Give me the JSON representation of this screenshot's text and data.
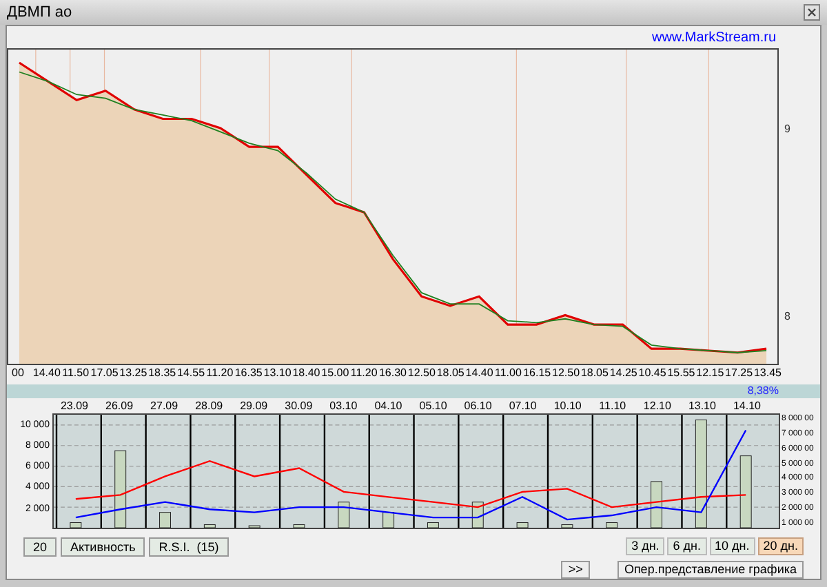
{
  "window": {
    "title": "ДВМП ао"
  },
  "link": "www.MarkStream.ru",
  "price_chart": {
    "chart_data": {
      "type": "area",
      "categories": [
        "00",
        "14.40",
        "11.50",
        "17.05",
        "13.25",
        "18.35",
        "14.55",
        "11.20",
        "16.35",
        "13.10",
        "18.40",
        "15.00",
        "11.20",
        "16.30",
        "12.50",
        "18.05",
        "14.40",
        "11.00",
        "16.15",
        "12.50",
        "18.05",
        "14.25",
        "10.45",
        "15.55",
        "12.15",
        "17.25",
        "13.45"
      ],
      "ylim": [
        7.74,
        9.42
      ],
      "yticks": [
        {
          "value": 9,
          "label": "9"
        },
        {
          "value": 8,
          "label": "8"
        }
      ],
      "grid": true,
      "series": [
        {
          "color": "#e00000",
          "values": [
            9.35,
            9.25,
            9.15,
            9.2,
            9.1,
            9.05,
            9.05,
            9.0,
            8.9,
            8.9,
            8.75,
            8.6,
            8.55,
            8.3,
            8.1,
            8.05,
            8.1,
            7.95,
            7.95,
            8.0,
            7.95,
            7.95,
            7.82,
            7.82,
            7.81,
            7.8,
            7.82
          ]
        },
        {
          "type": "line",
          "color": "#208020",
          "values": [
            9.3,
            9.25,
            9.18,
            9.16,
            9.1,
            9.07,
            9.04,
            8.98,
            8.92,
            8.88,
            8.76,
            8.62,
            8.55,
            8.32,
            8.12,
            8.06,
            8.06,
            7.97,
            7.96,
            7.98,
            7.95,
            7.94,
            7.84,
            7.82,
            7.81,
            7.8,
            7.81
          ]
        }
      ]
    }
  },
  "change": "8,38%",
  "volume_chart": {
    "chart_data": {
      "type": "line",
      "grid": true,
      "categories": [
        "23.09",
        "26.09",
        "27.09",
        "28.09",
        "29.09",
        "30.09",
        "03.10",
        "04.10",
        "05.10",
        "06.10",
        "07.10",
        "10.10",
        "11.10",
        "12.10",
        "13.10",
        "14.10"
      ],
      "ylim": [
        0,
        11000
      ],
      "yticks": [
        {
          "value": 10000,
          "label": "10 000"
        },
        {
          "value": 8000,
          "label": "8 000"
        },
        {
          "value": 6000,
          "label": "6 000"
        },
        {
          "value": 4000,
          "label": "4 000"
        },
        {
          "value": 2000,
          "label": "2 000"
        }
      ],
      "series": [
        {
          "color": "#ff0000",
          "values": [
            2800,
            3200,
            5000,
            6500,
            5000,
            5800,
            3500,
            3000,
            2500,
            2000,
            3500,
            3800,
            2000,
            2500,
            3000,
            3200
          ]
        },
        {
          "color": "#0000ff",
          "values": [
            1000,
            1800,
            2500,
            1800,
            1500,
            2000,
            2000,
            1500,
            1000,
            1000,
            3000,
            800,
            1200,
            2000,
            1500,
            9500
          ]
        },
        {
          "type": "bar",
          "color": "#c8d8c0",
          "values": [
            500,
            7500,
            1500,
            300,
            200,
            300,
            2500,
            1500,
            500,
            2500,
            500,
            300,
            500,
            4500,
            10500,
            7000
          ]
        }
      ]
    },
    "right_labels": [
      "8 000 00",
      "7 000 00",
      "6 000 00",
      "5 000 00",
      "4 000 00",
      "3 000 00",
      "2 000 00",
      "1 000 00"
    ]
  },
  "indicator_buttons": [
    "20",
    "Активность",
    "R.S.I.  (15)"
  ],
  "periods": [
    {
      "label": "3 дн.",
      "selected": false
    },
    {
      "label": "6 дн.",
      "selected": false
    },
    {
      "label": "10 дн.",
      "selected": false
    },
    {
      "label": "20 дн.",
      "selected": true
    }
  ],
  "nav_button": ">>",
  "mode_button": "Опер.представление графика"
}
